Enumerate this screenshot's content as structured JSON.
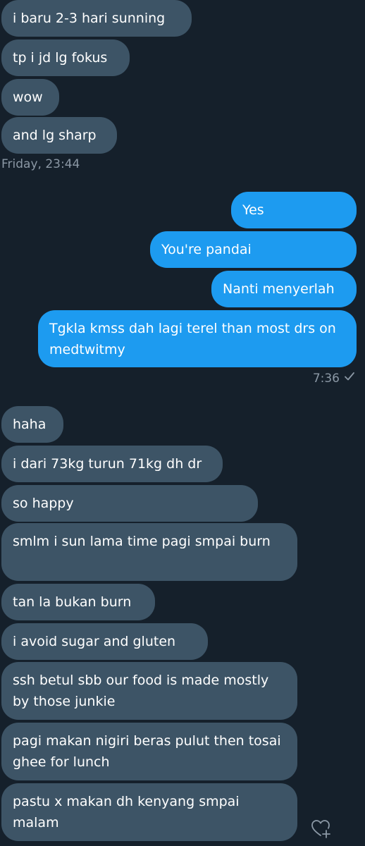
{
  "messages_before": [
    {
      "text": "i baru 2-3 hari sunning"
    },
    {
      "text": "tp i jd lg fokus"
    },
    {
      "text": "wow"
    },
    {
      "text": "and lg sharp"
    }
  ],
  "timestamp_friday": "Friday, 23:44",
  "sent_messages": [
    {
      "text": "Yes"
    },
    {
      "text": "You're pandai"
    },
    {
      "text": "Nanti menyerlah"
    },
    {
      "text": "Tgkla kmss dah lagi terel than most drs on medtwitmy"
    }
  ],
  "sent_time": "7:36",
  "sent_status_icon": "checkmark-icon",
  "received_messages": [
    {
      "text": "haha"
    },
    {
      "text": "i dari 73kg turun 71kg dh dr"
    },
    {
      "text": "so happy"
    },
    {
      "text": "smlm i sun lama time pagi smpai burn"
    },
    {
      "text": "tan la bukan burn"
    },
    {
      "text": "i avoid sugar and gluten"
    },
    {
      "text": "ssh betul sbb our food is made mostly by those junkie"
    },
    {
      "text": "pagi makan nigiri beras pulut then tosai ghee for lunch"
    },
    {
      "text": "pastu x makan dh kenyang smpai malam"
    }
  ],
  "react_icon": "heart-plus-icon",
  "colors": {
    "background": "#15202b",
    "incoming_bubble": "#3d5466",
    "outgoing_bubble": "#1d9bf0",
    "meta_text": "#8b98a5"
  }
}
